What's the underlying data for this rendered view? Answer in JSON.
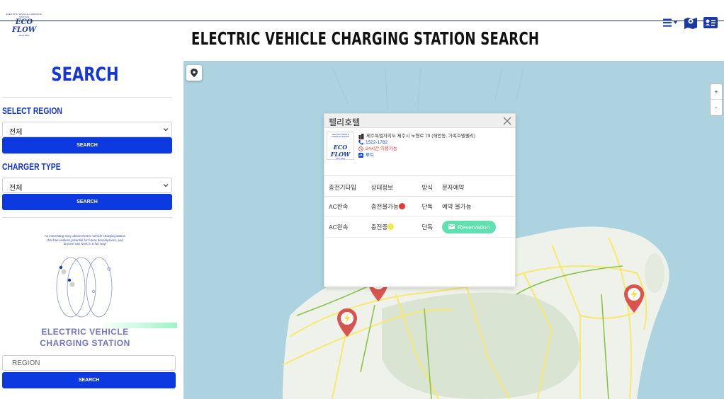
{
  "header": {
    "logo_top": "ELECTRIC VEHICLE CHARGING STATION",
    "logo_main": "ECO FLOW",
    "logo_sub": "Since 2024",
    "title": "ELECTRIC VEHICLE CHARGING STATION SEARCH",
    "icons": [
      "menu-icon",
      "map-icon",
      "contact-card-icon"
    ]
  },
  "sidebar": {
    "heading": "SEARCH",
    "region": {
      "label": "SELECT REGION",
      "value": "전체",
      "button": "SEARCH"
    },
    "charger": {
      "label": "CHARGER TYPE",
      "value": "전체",
      "button": "SEARCH"
    },
    "promo": {
      "text": "An interesting story about electric vehicle charging station that has endless potential for future development, and anyone can work in a fun way!",
      "title": "ELECTRIC VEHICLE CHARGING STATION"
    },
    "region_input": {
      "placeholder": "REGION"
    },
    "bottom_button": "SEARCH"
  },
  "map": {
    "zoom_in": "+",
    "zoom_out": "-",
    "popup": {
      "title": "펠리호텔",
      "logo_top": "ELECTRIC VEHICLE CHARGING STATION",
      "logo_main": "ECO FLOW",
      "logo_sub": "Since 2024",
      "address": "제주특별자치도 제주시 노형로 79 (해안동, 가족호텔펠리)",
      "phone": "1522-1782",
      "hours": "24시간 이용가능",
      "link": "루트",
      "table": {
        "headers": [
          "충전기타입",
          "상태정보",
          "방식",
          "문자예약"
        ],
        "rows": [
          {
            "type": "AC완속",
            "status": "충전불가능",
            "status_color": "#e53935",
            "method": "단독",
            "reserve": "예약 불가능"
          },
          {
            "type": "AC완속",
            "status": "충전중",
            "status_color": "#f2e94e",
            "method": "단독",
            "reserve": "Reservation"
          }
        ]
      }
    },
    "colors": {
      "sea": "#acd3df",
      "land": "#eef2ea",
      "marker": "#d9534f",
      "bolt": "#f5e33a",
      "road": "#f7e96b",
      "accent": "#1636d8"
    }
  }
}
